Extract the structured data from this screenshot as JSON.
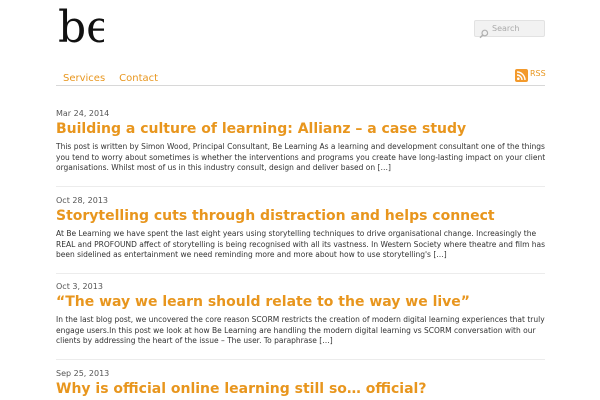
{
  "brand": {
    "logo_text": "be",
    "accent": "#e8961e"
  },
  "search": {
    "placeholder": "Search",
    "icon": "search-icon"
  },
  "nav": {
    "items": [
      {
        "label": "Services"
      },
      {
        "label": "Contact"
      }
    ]
  },
  "rss": {
    "label": "RSS",
    "icon": "rss-icon"
  },
  "posts": [
    {
      "date": "Mar 24, 2014",
      "title": "Building a culture of learning: Allianz – a case study",
      "excerpt": "This post is written by Simon Wood, Principal Consultant, Be Learning  As a learning and development consultant one of the things you tend to worry about sometimes is whether the interventions and programs you create have long-lasting impact on your client organisations. Whilst most of us in this industry consult, design and deliver based on […]"
    },
    {
      "date": "Oct 28, 2013",
      "title": "Storytelling cuts through distraction and helps connect",
      "excerpt": "At Be Learning we have spent the last eight years using storytelling techniques to drive organisational change. Increasingly the REAL and PROFOUND affect of storytelling is being recognised with all its vastness. In Western Society where theatre and film has been sidelined as entertainment we need reminding more and more about how to use storytelling's […]"
    },
    {
      "date": "Oct 3, 2013",
      "title": "“The way we learn should relate to the way we live”",
      "excerpt": "In the last blog post, we uncovered the core reason SCORM restricts the creation of modern digital learning experiences that truly engage users.In this post we look at how Be Learning are handling the modern digital learning vs SCORM conversation with our clients by addressing the heart of the issue – The user. To paraphrase […]"
    },
    {
      "date": "Sep 25, 2013",
      "title": "Why is official online learning still so… official?",
      "excerpt": ""
    }
  ]
}
